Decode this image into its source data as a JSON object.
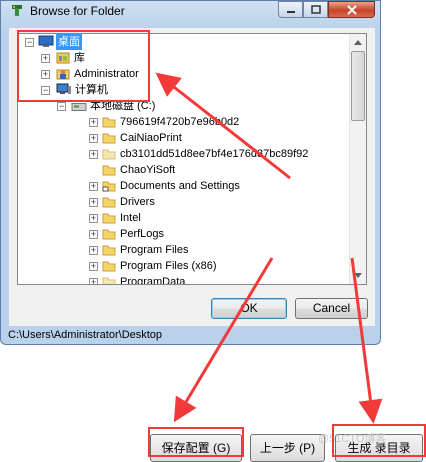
{
  "dialog": {
    "title": "Browse for Folder",
    "ok_label": "OK",
    "cancel_label": "Cancel",
    "status_path": "C:\\Users\\Administrator\\Desktop"
  },
  "tree": {
    "desktop": "桌面",
    "library": "库",
    "administrator": "Administrator",
    "computer": "计算机",
    "local_disk": "本地磁盘 (C:)",
    "folders": [
      "796619f4720b7e96b0d2",
      "CaiNiaoPrint",
      "cb3101dd51d8ee7bf4e176d37bc89f92",
      "ChaoYiSoft",
      "Documents and Settings",
      "Drivers",
      "Intel",
      "PerfLogs",
      "Program Files",
      "Program Files (x86)",
      "ProgramData"
    ]
  },
  "bottom_buttons": {
    "save_config": "保存配置 (G)",
    "prev_step": "上一步 (P)",
    "generate": "生成 录目录"
  },
  "watermark": "@51CTO博客",
  "colors": {
    "annotation": "#f23a3a",
    "selection": "#3399ff"
  }
}
